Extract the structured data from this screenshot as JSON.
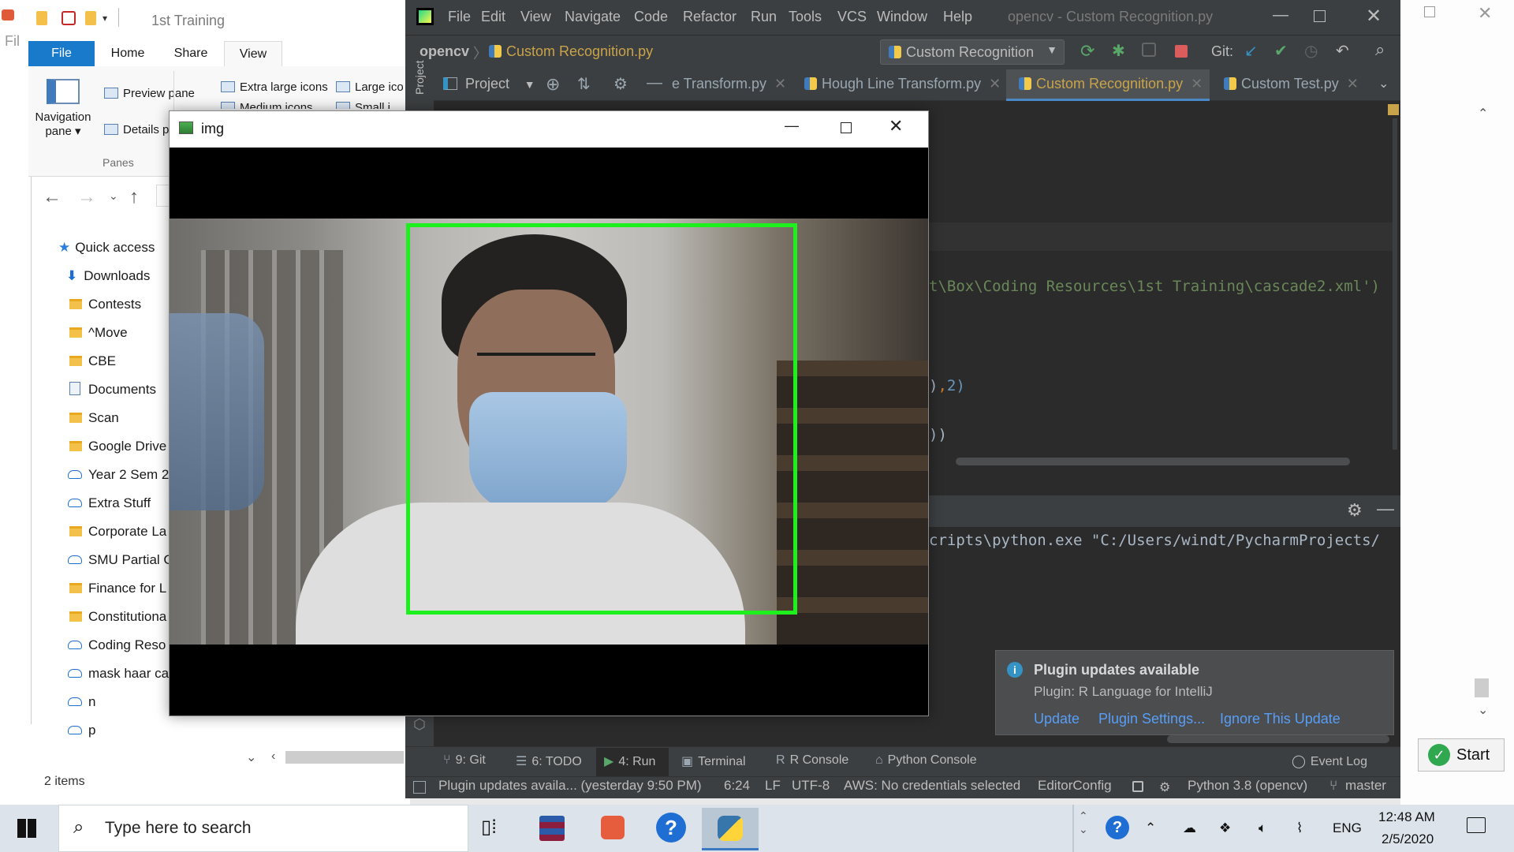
{
  "explorer": {
    "title": "1st Training",
    "side_label": "Fil",
    "tabs": {
      "file": "File",
      "home": "Home",
      "share": "Share",
      "view": "View"
    },
    "ribbon": {
      "navigation_pane": "Navigation",
      "navigation_pane_2": "pane",
      "preview_pane": "Preview pane",
      "details_pane": "Details p",
      "panes_group": "Panes",
      "extra_large_icons": "Extra large icons",
      "large_icons": "Large ico",
      "medium_icons": "Medium icons",
      "small_icons": "Small i"
    },
    "quick_access": [
      {
        "label": "Quick access",
        "icon": "star-icon"
      },
      {
        "label": "Downloads",
        "icon": "download-icon"
      },
      {
        "label": "Contests",
        "icon": "folder-icon"
      },
      {
        "label": "^Move",
        "icon": "folder-icon"
      },
      {
        "label": "CBE",
        "icon": "folder-icon"
      },
      {
        "label": "Documents",
        "icon": "documents-icon"
      },
      {
        "label": "Scan",
        "icon": "folder-icon"
      },
      {
        "label": "Google Drive",
        "icon": "folder-icon"
      },
      {
        "label": "Year 2 Sem 2",
        "icon": "cloud-folder-icon"
      },
      {
        "label": "Extra Stuff",
        "icon": "cloud-folder-icon"
      },
      {
        "label": "Corporate La",
        "icon": "folder-icon"
      },
      {
        "label": "SMU Partial C",
        "icon": "cloud-folder-icon"
      },
      {
        "label": "Finance for L",
        "icon": "folder-icon"
      },
      {
        "label": "Constitutiona",
        "icon": "folder-icon"
      },
      {
        "label": "Coding Reso",
        "icon": "cloud-folder-icon"
      },
      {
        "label": "mask haar ca",
        "icon": "cloud-folder-icon"
      },
      {
        "label": "n",
        "icon": "cloud-folder-icon"
      },
      {
        "label": "p",
        "icon": "cloud-folder-icon"
      }
    ],
    "status": "2 items"
  },
  "pycharm": {
    "menu": [
      "File",
      "Edit",
      "View",
      "Navigate",
      "Code",
      "Refactor",
      "Run",
      "Tools",
      "VCS",
      "Window",
      "Help"
    ],
    "window_title": "opencv - Custom Recognition.py",
    "breadcrumb_project": "opencv",
    "breadcrumb_file": "Custom Recognition.py",
    "run_config": "Custom Recognition",
    "git_label": "Git:",
    "project_label": "Project",
    "sidestrip_label": "Project",
    "tabs": [
      "e Transform.py",
      "Hough Line Transform.py",
      "Custom Recognition.py",
      "Custom Test.py"
    ],
    "code": {
      "line1": "t\\Box\\Coding Resources\\1st Training\\cascade2.xml')",
      "line2a": ")",
      "line2b": ",",
      "line2c": "2)",
      "line3": "))"
    },
    "run_output": "cripts\\python.exe \"C:/Users/windt/PycharmProjects/",
    "notification": {
      "title": "Plugin updates available",
      "body": "Plugin: R Language for IntelliJ",
      "links": [
        "Update",
        "Plugin Settings...",
        "Ignore This Update"
      ]
    },
    "tool_windows": [
      {
        "label": "9: Git",
        "icon": "git-icon"
      },
      {
        "label": "6: TODO",
        "icon": "todo-icon"
      },
      {
        "label": "4: Run",
        "icon": "run-icon"
      },
      {
        "label": "Terminal",
        "icon": "terminal-icon"
      },
      {
        "label": "R Console",
        "icon": "r-console-icon"
      },
      {
        "label": "Python Console",
        "icon": "python-console-icon"
      }
    ],
    "event_log": "Event Log",
    "status": {
      "message": "Plugin updates availa... (yesterday 9:50 PM)",
      "position": "6:24",
      "line_sep": "LF",
      "encoding": "UTF-8",
      "aws": "AWS: No credentials selected",
      "editorconfig": "EditorConfig",
      "interpreter": "Python 3.8 (opencv)",
      "branch": "master"
    }
  },
  "img_window": {
    "title": "img",
    "detection_color": "#1ef01e"
  },
  "start_button": "Start",
  "taskbar": {
    "search_placeholder": "Type here to search",
    "language": "ENG",
    "time": "12:48 AM",
    "date": "2/5/2020"
  }
}
